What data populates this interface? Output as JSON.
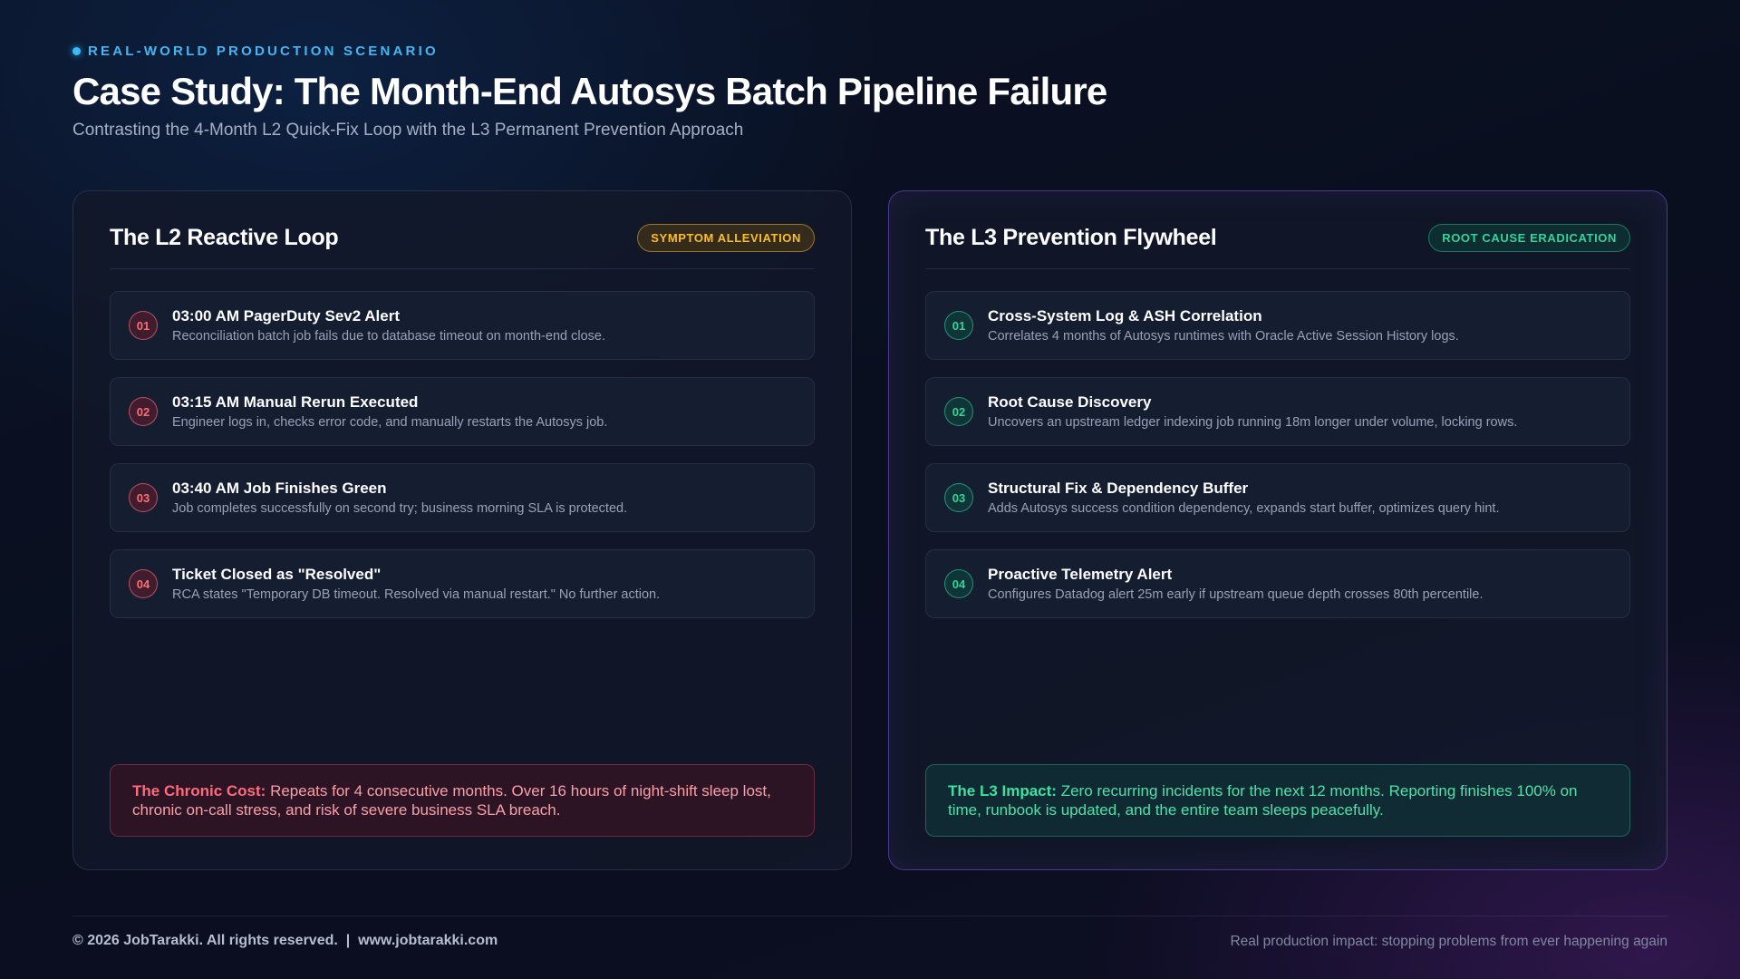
{
  "header": {
    "eyebrow": "REAL-WORLD PRODUCTION SCENARIO",
    "title": "Case Study: The Month-End Autosys Batch Pipeline Failure",
    "subtitle": "Contrasting the 4-Month L2 Quick-Fix Loop with the L3 Permanent Prevention Approach"
  },
  "left": {
    "title": "The L2 Reactive Loop",
    "badge": "SYMPTOM ALLEVIATION",
    "steps": [
      {
        "num": "01",
        "title": "03:00 AM PagerDuty Sev2 Alert",
        "desc": "Reconciliation batch job fails due to database timeout on month-end close."
      },
      {
        "num": "02",
        "title": "03:15 AM Manual Rerun Executed",
        "desc": "Engineer logs in, checks error code, and manually restarts the Autosys job."
      },
      {
        "num": "03",
        "title": "03:40 AM Job Finishes Green",
        "desc": "Job completes successfully on second try; business morning SLA is protected."
      },
      {
        "num": "04",
        "title": "Ticket Closed as \"Resolved\"",
        "desc": "RCA states \"Temporary DB timeout. Resolved via manual restart.\" No further action."
      }
    ],
    "callout_lead": "The Chronic Cost:",
    "callout_text": " Repeats for 4 consecutive months. Over 16 hours of night-shift sleep lost, chronic on-call stress, and risk of severe business SLA breach."
  },
  "right": {
    "title": "The L3 Prevention Flywheel",
    "badge": "ROOT CAUSE ERADICATION",
    "steps": [
      {
        "num": "01",
        "title": "Cross-System Log & ASH Correlation",
        "desc": "Correlates 4 months of Autosys runtimes with Oracle Active Session History logs."
      },
      {
        "num": "02",
        "title": "Root Cause Discovery",
        "desc": "Uncovers an upstream ledger indexing job running 18m longer under volume, locking rows."
      },
      {
        "num": "03",
        "title": "Structural Fix & Dependency Buffer",
        "desc": "Adds Autosys success condition dependency, expands start buffer, optimizes query hint."
      },
      {
        "num": "04",
        "title": "Proactive Telemetry Alert",
        "desc": "Configures Datadog alert 25m early if upstream queue depth crosses 80th percentile."
      }
    ],
    "callout_lead": "The L3 Impact:",
    "callout_text": " Zero recurring incidents for the next 12 months. Reporting finishes 100% on time, runbook is updated, and the entire team sleeps peacefully."
  },
  "footer": {
    "left": "© 2026 JobTarakki. All rights reserved.  |  www.jobtarakki.com",
    "right": "Real production impact: stopping problems from ever happening again"
  },
  "colors": {
    "accent_blue": "#38bdf8",
    "alert_red": "#f87171",
    "success_green": "#34d399",
    "badge_amber": "#fbbf24"
  }
}
